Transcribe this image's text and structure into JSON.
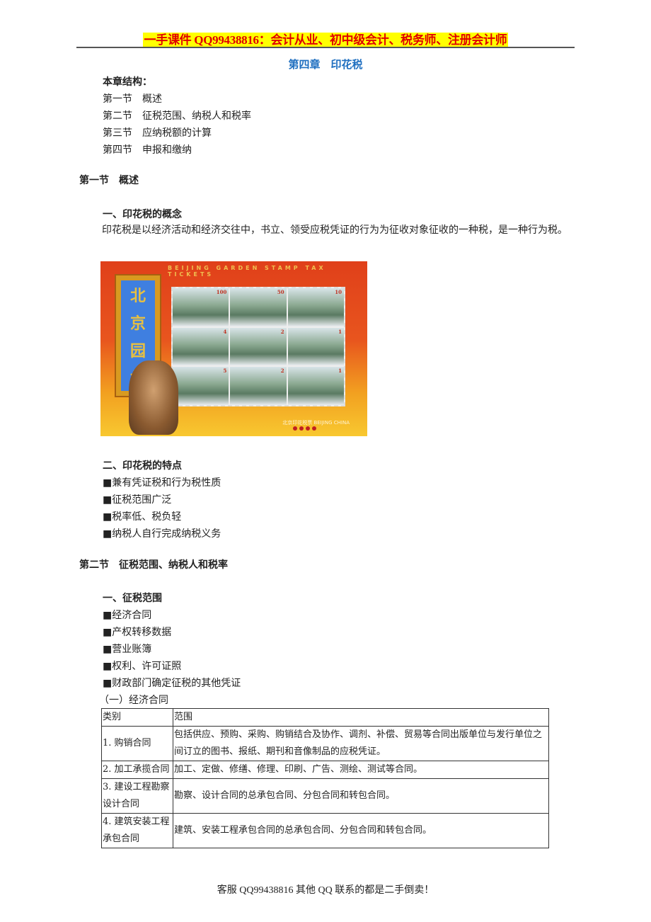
{
  "header": {
    "banner": "一手课件 QQ99438816：会计从业、初中级会计、税务师、注册会计师",
    "chapter_title": "第四章　印花税"
  },
  "structure": {
    "heading": "本章结构：",
    "items": [
      "第一节　概述",
      "第二节　征税范围、纳税人和税率",
      "第三节　应纳税额的计算",
      "第四节　申报和缴纳"
    ]
  },
  "section1": {
    "title": "第一节　概述",
    "sub1": {
      "title": "一、印花税的概念",
      "paragraph": "印花税是以经济活动和经济交往中，书立、领受应税凭证的行为为征收对象征收的一种税，是一种行为税。"
    },
    "image": {
      "caption": "BEIJING GARDEN STAMP TAX TICKETS",
      "vertical_title": [
        "北",
        "京",
        "园",
        "林"
      ],
      "values": [
        "100",
        "50",
        "10",
        "4",
        "2",
        "1",
        "5",
        "2",
        "1"
      ],
      "brand": "北京印花税票 BEIJING CHINA"
    },
    "sub2": {
      "title": "二、印花税的特点",
      "bullets": [
        "■兼有凭证税和行为税性质",
        "■征税范围广泛",
        "■税率低、税负轻",
        "■纳税人自行完成纳税义务"
      ]
    }
  },
  "section2": {
    "title": "第二节　征税范围、纳税人和税率",
    "sub1": {
      "title": "一、征税范围",
      "bullets": [
        "■经济合同",
        "■产权转移数据",
        "■营业账簿",
        "■权利、许可证照",
        "■财政部门确定征税的其他凭证"
      ]
    },
    "table_caption": "（一）经济合同",
    "table": {
      "headers": [
        "类别",
        "范围"
      ],
      "rows": [
        [
          "1. 购销合同",
          "包括供应、预购、采购、购销结合及协作、调剂、补偿、贸易等合同出版单位与发行单位之间订立的图书、报纸、期刊和音像制品的应税凭证。"
        ],
        [
          "2. 加工承揽合同",
          "加工、定做、修缮、修理、印刷、广告、测绘、测试等合同。"
        ],
        [
          "3. 建设工程勘察设计合同",
          "勘察、设计合同的总承包合同、分包合同和转包合同。"
        ],
        [
          "4. 建筑安装工程承包合同",
          "建筑、安装工程承包合同的总承包合同、分包合同和转包合同。"
        ]
      ]
    }
  },
  "footer": {
    "text": "客服 QQ99438816  其他 QQ 联系的都是二手倒卖！"
  }
}
